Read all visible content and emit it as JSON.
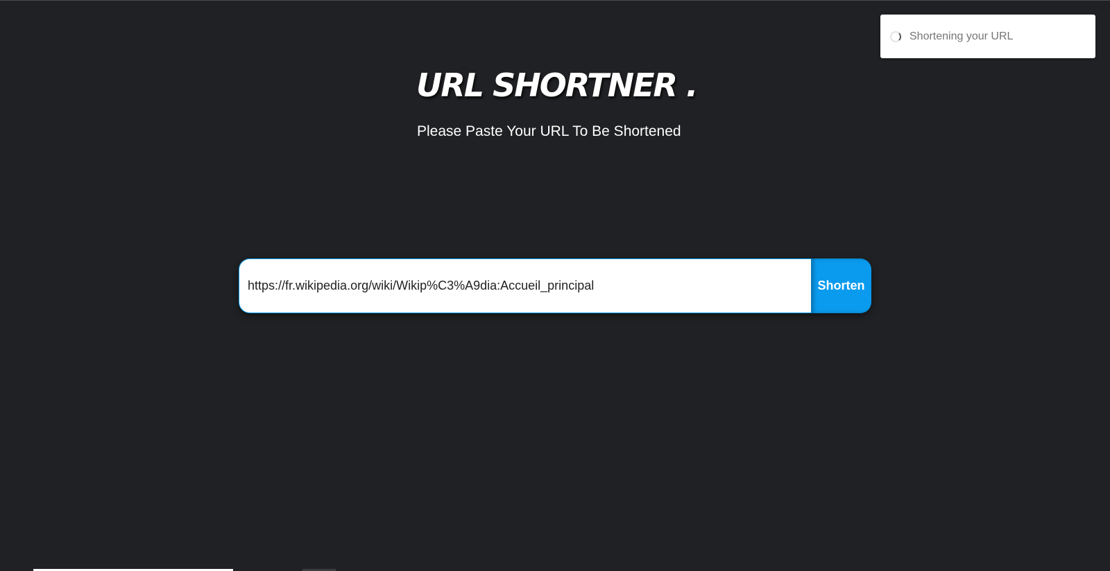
{
  "header": {
    "title": "URL SHORTNER .",
    "subtitle": "Please Paste Your URL To Be Shortened"
  },
  "toast": {
    "icon": "loading-spinner-icon",
    "message": "Shortening your URL"
  },
  "form": {
    "url_value": "https://fr.wikipedia.org/wiki/Wikip%C3%A9dia:Accueil_principal",
    "button_label": "Shorten"
  },
  "colors": {
    "background": "#202124",
    "accent": "#0a9bef",
    "input_border": "#0a9ff0",
    "toast_background": "#ffffff",
    "toast_text": "#757575"
  }
}
